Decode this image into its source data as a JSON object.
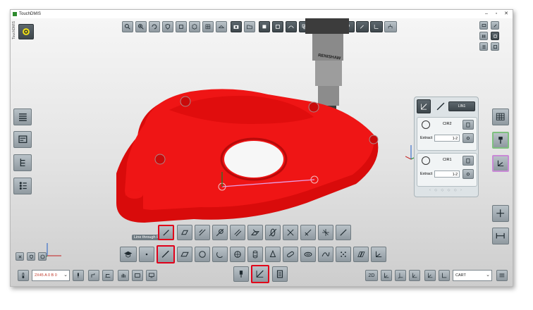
{
  "window": {
    "title": "TouchDMIS"
  },
  "tooltip": "Line through Points",
  "features": [
    {
      "name": "CIR2",
      "extract": "Extract",
      "range": "1-2"
    },
    {
      "name": "CIR1",
      "extract": "Extract",
      "range": "1-2"
    }
  ],
  "feature_panel": {
    "header_tag": "LIN1"
  },
  "bottom": {
    "probe_select": "2X45 A 0 B 0",
    "view_2d": "2D",
    "system_select": "CART"
  },
  "probe_brand": "RENISHAW",
  "colors": {
    "part": "#ef0f0f",
    "selected_border": "#e0001a",
    "button": "#9aa3a9"
  }
}
